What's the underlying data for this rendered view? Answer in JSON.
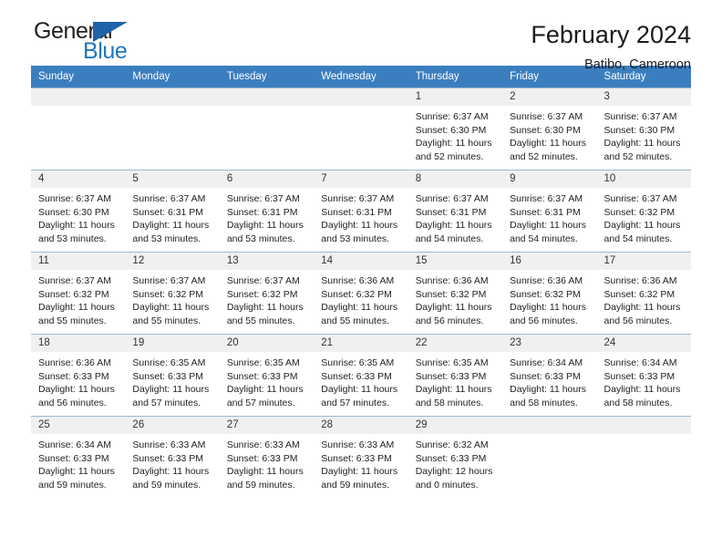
{
  "brand": {
    "name_part1": "General",
    "name_part2": "Blue",
    "accent_color": "#1f76bd",
    "triangle_color": "#1f63a8",
    "triangle_icon": "triangle-icon"
  },
  "header": {
    "title": "February 2024",
    "subtitle": "Batibo, Cameroon"
  },
  "calendar": {
    "header_bg": "#3b7ebf",
    "daynum_bg": "#f0f0f0",
    "weekdays": [
      "Sunday",
      "Monday",
      "Tuesday",
      "Wednesday",
      "Thursday",
      "Friday",
      "Saturday"
    ],
    "labels": {
      "sunrise": "Sunrise:",
      "sunset": "Sunset:",
      "daylight": "Daylight:"
    },
    "weeks": [
      [
        {
          "day": "",
          "sunrise": "",
          "sunset": "",
          "daylight_line1": "",
          "daylight_line2": ""
        },
        {
          "day": "",
          "sunrise": "",
          "sunset": "",
          "daylight_line1": "",
          "daylight_line2": ""
        },
        {
          "day": "",
          "sunrise": "",
          "sunset": "",
          "daylight_line1": "",
          "daylight_line2": ""
        },
        {
          "day": "",
          "sunrise": "",
          "sunset": "",
          "daylight_line1": "",
          "daylight_line2": ""
        },
        {
          "day": "1",
          "sunrise": "Sunrise: 6:37 AM",
          "sunset": "Sunset: 6:30 PM",
          "daylight_line1": "Daylight: 11 hours",
          "daylight_line2": "and 52 minutes."
        },
        {
          "day": "2",
          "sunrise": "Sunrise: 6:37 AM",
          "sunset": "Sunset: 6:30 PM",
          "daylight_line1": "Daylight: 11 hours",
          "daylight_line2": "and 52 minutes."
        },
        {
          "day": "3",
          "sunrise": "Sunrise: 6:37 AM",
          "sunset": "Sunset: 6:30 PM",
          "daylight_line1": "Daylight: 11 hours",
          "daylight_line2": "and 52 minutes."
        }
      ],
      [
        {
          "day": "4",
          "sunrise": "Sunrise: 6:37 AM",
          "sunset": "Sunset: 6:30 PM",
          "daylight_line1": "Daylight: 11 hours",
          "daylight_line2": "and 53 minutes."
        },
        {
          "day": "5",
          "sunrise": "Sunrise: 6:37 AM",
          "sunset": "Sunset: 6:31 PM",
          "daylight_line1": "Daylight: 11 hours",
          "daylight_line2": "and 53 minutes."
        },
        {
          "day": "6",
          "sunrise": "Sunrise: 6:37 AM",
          "sunset": "Sunset: 6:31 PM",
          "daylight_line1": "Daylight: 11 hours",
          "daylight_line2": "and 53 minutes."
        },
        {
          "day": "7",
          "sunrise": "Sunrise: 6:37 AM",
          "sunset": "Sunset: 6:31 PM",
          "daylight_line1": "Daylight: 11 hours",
          "daylight_line2": "and 53 minutes."
        },
        {
          "day": "8",
          "sunrise": "Sunrise: 6:37 AM",
          "sunset": "Sunset: 6:31 PM",
          "daylight_line1": "Daylight: 11 hours",
          "daylight_line2": "and 54 minutes."
        },
        {
          "day": "9",
          "sunrise": "Sunrise: 6:37 AM",
          "sunset": "Sunset: 6:31 PM",
          "daylight_line1": "Daylight: 11 hours",
          "daylight_line2": "and 54 minutes."
        },
        {
          "day": "10",
          "sunrise": "Sunrise: 6:37 AM",
          "sunset": "Sunset: 6:32 PM",
          "daylight_line1": "Daylight: 11 hours",
          "daylight_line2": "and 54 minutes."
        }
      ],
      [
        {
          "day": "11",
          "sunrise": "Sunrise: 6:37 AM",
          "sunset": "Sunset: 6:32 PM",
          "daylight_line1": "Daylight: 11 hours",
          "daylight_line2": "and 55 minutes."
        },
        {
          "day": "12",
          "sunrise": "Sunrise: 6:37 AM",
          "sunset": "Sunset: 6:32 PM",
          "daylight_line1": "Daylight: 11 hours",
          "daylight_line2": "and 55 minutes."
        },
        {
          "day": "13",
          "sunrise": "Sunrise: 6:37 AM",
          "sunset": "Sunset: 6:32 PM",
          "daylight_line1": "Daylight: 11 hours",
          "daylight_line2": "and 55 minutes."
        },
        {
          "day": "14",
          "sunrise": "Sunrise: 6:36 AM",
          "sunset": "Sunset: 6:32 PM",
          "daylight_line1": "Daylight: 11 hours",
          "daylight_line2": "and 55 minutes."
        },
        {
          "day": "15",
          "sunrise": "Sunrise: 6:36 AM",
          "sunset": "Sunset: 6:32 PM",
          "daylight_line1": "Daylight: 11 hours",
          "daylight_line2": "and 56 minutes."
        },
        {
          "day": "16",
          "sunrise": "Sunrise: 6:36 AM",
          "sunset": "Sunset: 6:32 PM",
          "daylight_line1": "Daylight: 11 hours",
          "daylight_line2": "and 56 minutes."
        },
        {
          "day": "17",
          "sunrise": "Sunrise: 6:36 AM",
          "sunset": "Sunset: 6:32 PM",
          "daylight_line1": "Daylight: 11 hours",
          "daylight_line2": "and 56 minutes."
        }
      ],
      [
        {
          "day": "18",
          "sunrise": "Sunrise: 6:36 AM",
          "sunset": "Sunset: 6:33 PM",
          "daylight_line1": "Daylight: 11 hours",
          "daylight_line2": "and 56 minutes."
        },
        {
          "day": "19",
          "sunrise": "Sunrise: 6:35 AM",
          "sunset": "Sunset: 6:33 PM",
          "daylight_line1": "Daylight: 11 hours",
          "daylight_line2": "and 57 minutes."
        },
        {
          "day": "20",
          "sunrise": "Sunrise: 6:35 AM",
          "sunset": "Sunset: 6:33 PM",
          "daylight_line1": "Daylight: 11 hours",
          "daylight_line2": "and 57 minutes."
        },
        {
          "day": "21",
          "sunrise": "Sunrise: 6:35 AM",
          "sunset": "Sunset: 6:33 PM",
          "daylight_line1": "Daylight: 11 hours",
          "daylight_line2": "and 57 minutes."
        },
        {
          "day": "22",
          "sunrise": "Sunrise: 6:35 AM",
          "sunset": "Sunset: 6:33 PM",
          "daylight_line1": "Daylight: 11 hours",
          "daylight_line2": "and 58 minutes."
        },
        {
          "day": "23",
          "sunrise": "Sunrise: 6:34 AM",
          "sunset": "Sunset: 6:33 PM",
          "daylight_line1": "Daylight: 11 hours",
          "daylight_line2": "and 58 minutes."
        },
        {
          "day": "24",
          "sunrise": "Sunrise: 6:34 AM",
          "sunset": "Sunset: 6:33 PM",
          "daylight_line1": "Daylight: 11 hours",
          "daylight_line2": "and 58 minutes."
        }
      ],
      [
        {
          "day": "25",
          "sunrise": "Sunrise: 6:34 AM",
          "sunset": "Sunset: 6:33 PM",
          "daylight_line1": "Daylight: 11 hours",
          "daylight_line2": "and 59 minutes."
        },
        {
          "day": "26",
          "sunrise": "Sunrise: 6:33 AM",
          "sunset": "Sunset: 6:33 PM",
          "daylight_line1": "Daylight: 11 hours",
          "daylight_line2": "and 59 minutes."
        },
        {
          "day": "27",
          "sunrise": "Sunrise: 6:33 AM",
          "sunset": "Sunset: 6:33 PM",
          "daylight_line1": "Daylight: 11 hours",
          "daylight_line2": "and 59 minutes."
        },
        {
          "day": "28",
          "sunrise": "Sunrise: 6:33 AM",
          "sunset": "Sunset: 6:33 PM",
          "daylight_line1": "Daylight: 11 hours",
          "daylight_line2": "and 59 minutes."
        },
        {
          "day": "29",
          "sunrise": "Sunrise: 6:32 AM",
          "sunset": "Sunset: 6:33 PM",
          "daylight_line1": "Daylight: 12 hours",
          "daylight_line2": "and 0 minutes."
        },
        {
          "day": "",
          "sunrise": "",
          "sunset": "",
          "daylight_line1": "",
          "daylight_line2": ""
        },
        {
          "day": "",
          "sunrise": "",
          "sunset": "",
          "daylight_line1": "",
          "daylight_line2": ""
        }
      ]
    ]
  }
}
